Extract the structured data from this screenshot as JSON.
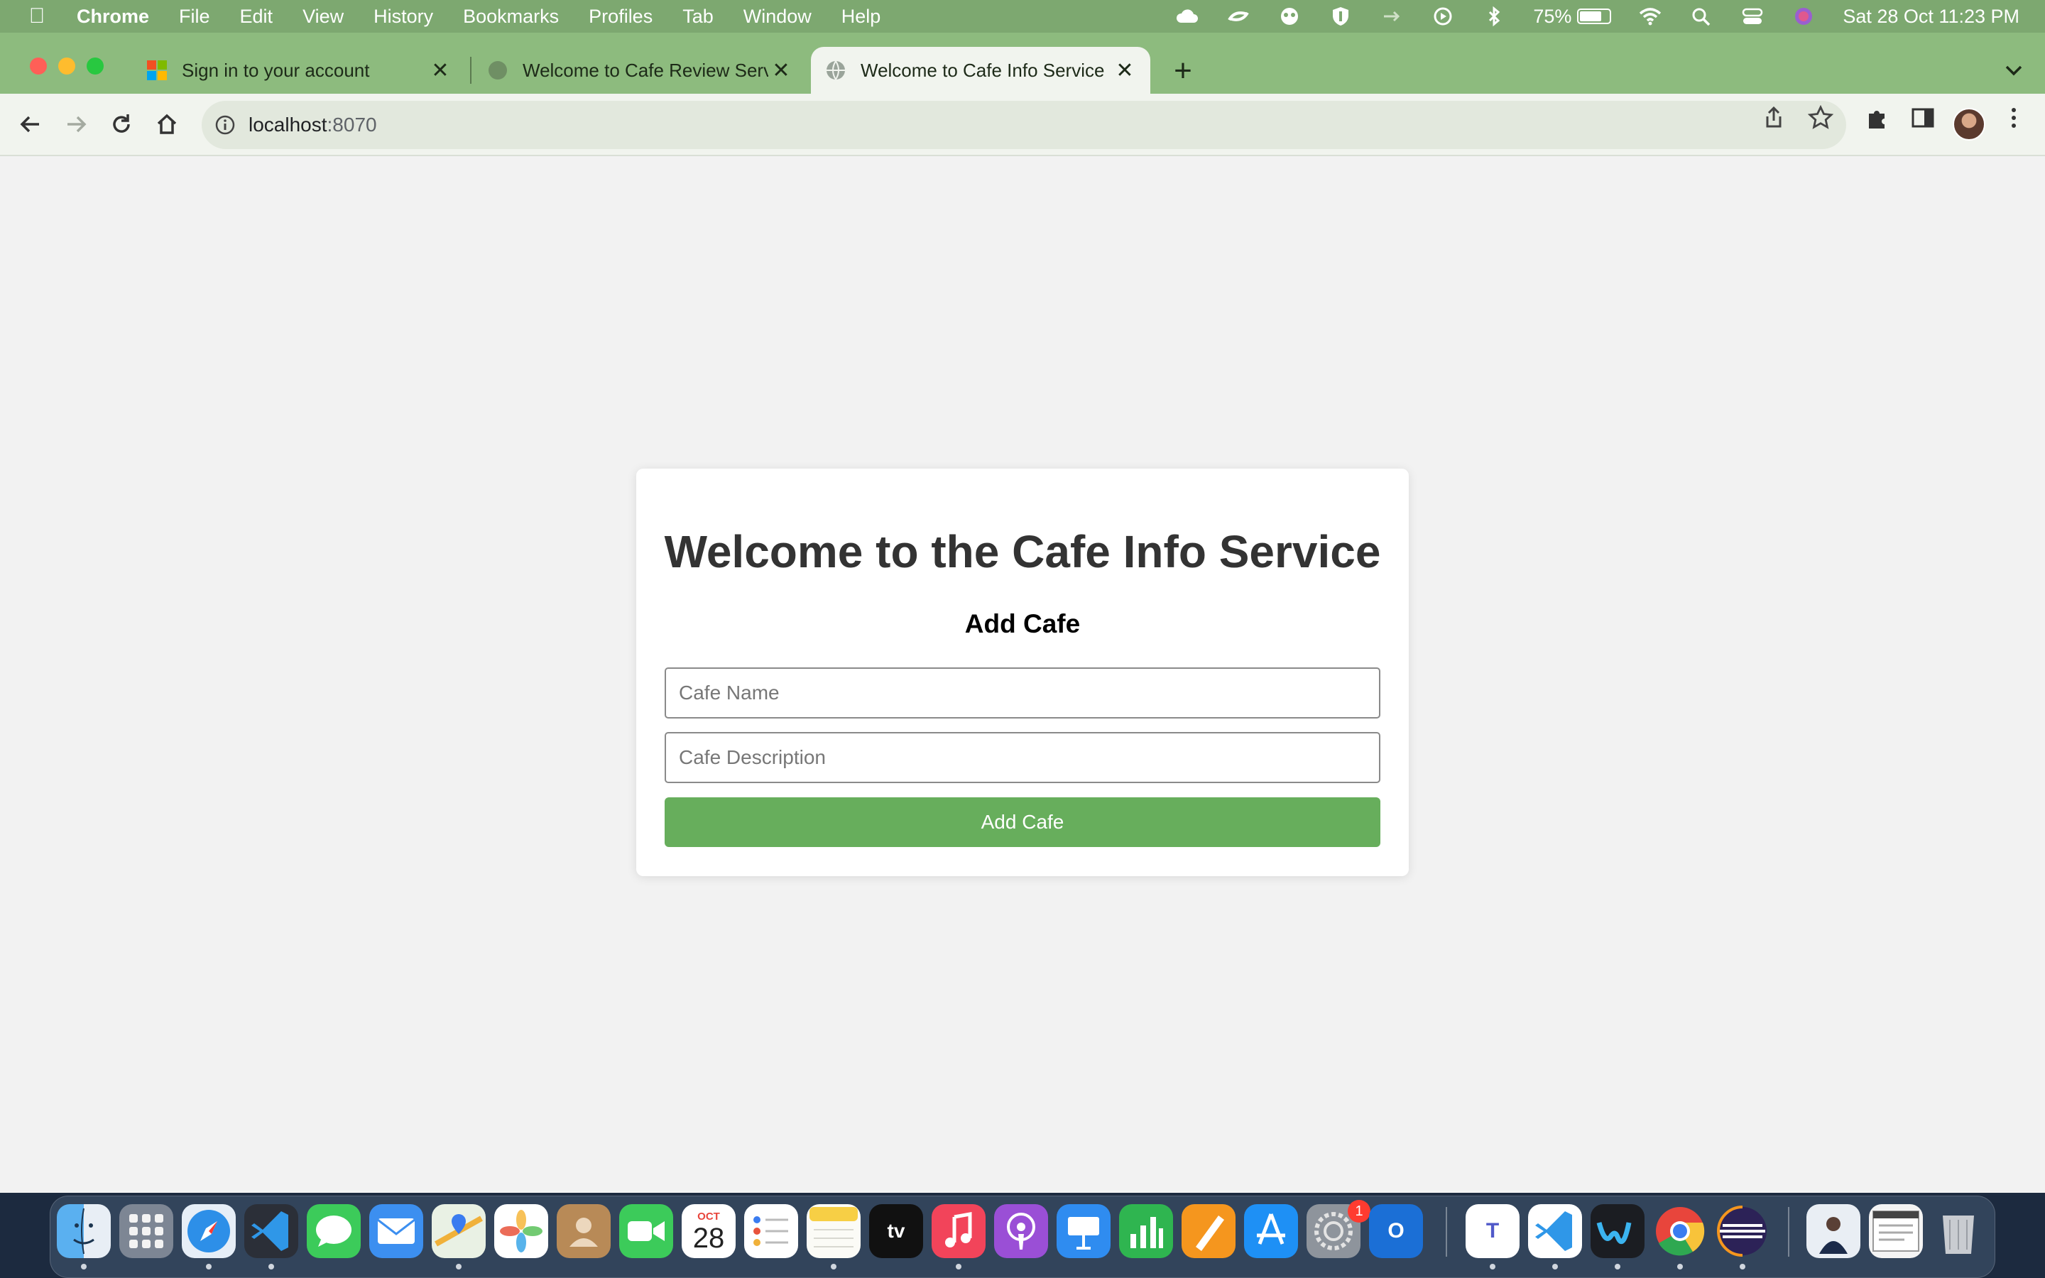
{
  "menubar": {
    "app_name": "Chrome",
    "items": [
      "File",
      "Edit",
      "View",
      "History",
      "Bookmarks",
      "Profiles",
      "Tab",
      "Window",
      "Help"
    ],
    "battery_percent": "75%",
    "battery_level": 0.75,
    "datetime": "Sat 28 Oct  11:23 PM",
    "status_icons": [
      "cloud-icon",
      "sync-icon",
      "eye-icon",
      "shield-icon",
      "arrow-icon",
      "play-icon",
      "bluetooth-icon",
      "battery-icon",
      "wifi-icon",
      "spotlight-icon",
      "control-center-icon",
      "siri-icon"
    ]
  },
  "browser": {
    "tabs": [
      {
        "title": "Sign in to your account",
        "favicon": "microsoft-icon",
        "active": false
      },
      {
        "title": "Welcome to Cafe Review Service",
        "favicon": "globe-icon",
        "active": false
      },
      {
        "title": "Welcome to Cafe Info Service",
        "favicon": "globe-icon",
        "active": true
      }
    ],
    "address": {
      "host": "localhost",
      "port": ":8070"
    }
  },
  "page": {
    "heading": "Welcome to the Cafe Info Service",
    "subheading": "Add Cafe",
    "fields": {
      "cafe_name_placeholder": "Cafe Name",
      "cafe_description_placeholder": "Cafe Description"
    },
    "submit_label": "Add Cafe",
    "colors": {
      "button": "#67ae5c",
      "heading": "#333333",
      "background": "#f2f2f2"
    }
  },
  "dock": {
    "apps": [
      "finder-icon",
      "launchpad-icon",
      "safari-icon",
      "vscode-icon",
      "messages-icon",
      "mail-icon",
      "maps-icon",
      "photos-icon",
      "contacts-icon",
      "facetime-icon",
      "calendar-icon",
      "reminders-icon",
      "notes-icon",
      "tv-icon",
      "music-icon",
      "podcasts-icon",
      "keynote-icon",
      "numbers-icon",
      "pages-icon",
      "app-store-icon",
      "system-settings-icon",
      "outlook-icon",
      "teams-icon",
      "vscode-icon",
      "webex-icon",
      "chrome-icon",
      "eclipse-icon",
      "portrait-icon",
      "document-icon",
      "trash-icon"
    ],
    "calendar_month": "OCT",
    "calendar_day": "28",
    "tv_label": "tv",
    "settings_badge": "1",
    "outlook_letter": "O",
    "teams_letter": "T"
  }
}
